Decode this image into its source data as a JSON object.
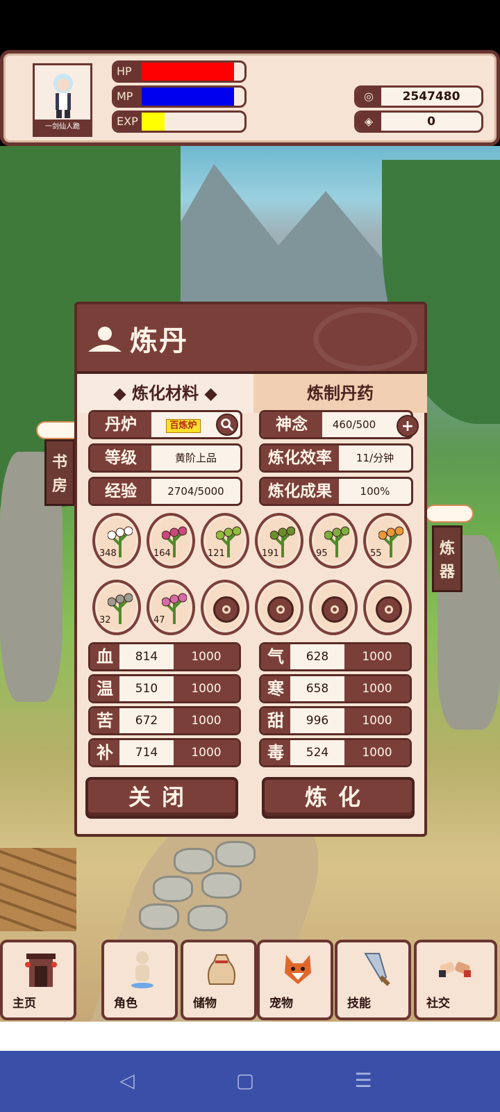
{
  "header": {
    "avatar_name": "一剑仙人跪",
    "bars": [
      {
        "label": "HP",
        "fill": 0.9,
        "color": "#ff0000"
      },
      {
        "label": "MP",
        "fill": 0.9,
        "color": "#0000ee"
      },
      {
        "label": "EXP",
        "fill": 0.22,
        "color": "#ffff00"
      }
    ],
    "currency": [
      {
        "icon": "coin-icon",
        "symbol": "◎",
        "value": "2547480"
      },
      {
        "icon": "gem-icon",
        "symbol": "◈",
        "value": "0"
      }
    ]
  },
  "side": {
    "left_label": "书房",
    "right_label": "炼器"
  },
  "dialog": {
    "title": "炼丹",
    "tabs": {
      "materials": "◆ 炼化材料 ◆",
      "pills": "炼制丹药"
    },
    "furnace_key": "丹炉",
    "furnace_value": "百炼炉",
    "level_key": "等级",
    "level_value": "黄阶上品",
    "exp_key": "经验",
    "exp_value": "2704/5000",
    "spirit_key": "神念",
    "spirit_value": "460/500",
    "efficiency_key": "炼化效率",
    "efficiency_value": "11/分钟",
    "result_key": "炼化成果",
    "result_value": "100%",
    "herbs": [
      {
        "count": "348",
        "color": "#ffffff"
      },
      {
        "count": "164",
        "color": "#c84a7c"
      },
      {
        "count": "121",
        "color": "#8fbf3a"
      },
      {
        "count": "191",
        "color": "#6b8f2a"
      },
      {
        "count": "95",
        "color": "#7cae3c"
      },
      {
        "count": "55",
        "color": "#e89a3a"
      },
      {
        "count": "32",
        "color": "#9b9b8f"
      },
      {
        "count": "47",
        "color": "#d76aa8"
      }
    ],
    "locked_slots": 4,
    "stats_left": [
      {
        "key": "血",
        "value": "814",
        "max": "1000"
      },
      {
        "key": "温",
        "value": "510",
        "max": "1000"
      },
      {
        "key": "苦",
        "value": "672",
        "max": "1000"
      },
      {
        "key": "补",
        "value": "714",
        "max": "1000"
      }
    ],
    "stats_right": [
      {
        "key": "气",
        "value": "628",
        "max": "1000"
      },
      {
        "key": "寒",
        "value": "658",
        "max": "1000"
      },
      {
        "key": "甜",
        "value": "996",
        "max": "1000"
      },
      {
        "key": "毒",
        "value": "524",
        "max": "1000"
      }
    ],
    "close_label": "关闭",
    "refine_label": "炼化"
  },
  "nav": [
    {
      "label": "主页",
      "icon": "home-gate-icon"
    },
    {
      "label": "角色",
      "icon": "character-icon"
    },
    {
      "label": "储物",
      "icon": "bag-icon"
    },
    {
      "label": "宠物",
      "icon": "fox-pet-icon"
    },
    {
      "label": "技能",
      "icon": "sword-icon"
    },
    {
      "label": "社交",
      "icon": "handshake-icon"
    }
  ],
  "system_nav": {
    "back": "◁",
    "home": "▢",
    "menu": "☰"
  }
}
